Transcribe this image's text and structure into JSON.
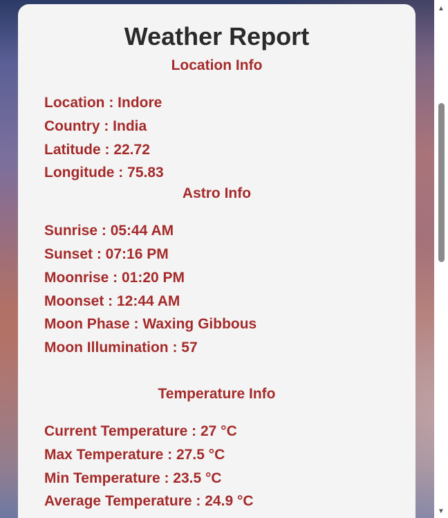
{
  "title": "Weather Report",
  "location_section": {
    "heading": "Location Info",
    "rows": [
      "Location : Indore",
      "Country : India",
      "Latitude : 22.72",
      "Longitude : 75.83"
    ]
  },
  "astro_section": {
    "heading": "Astro Info",
    "rows": [
      "Sunrise : 05:44 AM",
      "Sunset : 07:16 PM",
      "Moonrise : 01:20 PM",
      "Moonset : 12:44 AM",
      "Moon Phase : Waxing Gibbous",
      "Moon Illumination : 57"
    ]
  },
  "temperature_section": {
    "heading": "Temperature Info",
    "rows": [
      "Current Temperature : 27 °C",
      "Max Temperature : 27.5 °C",
      "Min Temperature : 23.5 °C",
      "Average Temperature : 24.9 °C"
    ]
  },
  "scrollbar": {
    "up_icon": "▲",
    "down_icon": "▼",
    "scroll_position": 0.27
  },
  "colors": {
    "heading_text": "#a52a2a",
    "title_text": "#2a2a2a",
    "card_background": "#f4f4f4"
  }
}
